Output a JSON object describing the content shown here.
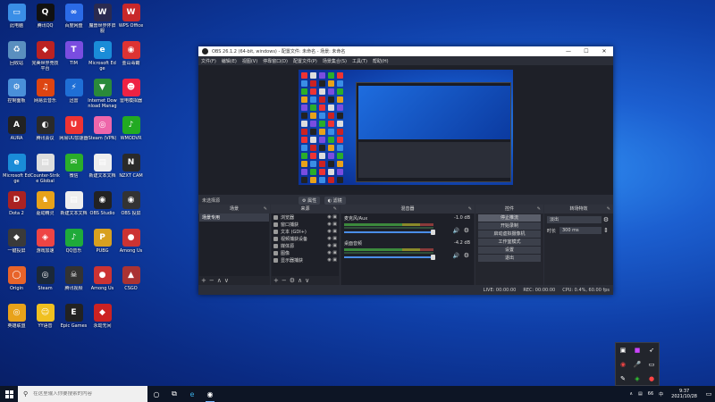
{
  "desktop": {
    "icons": [
      {
        "label": "此电脑",
        "glyph": "▭",
        "color": "#3a8ee6"
      },
      {
        "label": "腾讯QQ",
        "glyph": "Q",
        "color": "#111"
      },
      {
        "label": "百度网盘",
        "glyph": "∞",
        "color": "#2b6be6"
      },
      {
        "label": "魔兽世界怀旧服",
        "glyph": "W",
        "color": "#2a2a50"
      },
      {
        "label": "WPS Office",
        "glyph": "W",
        "color": "#c8282a"
      },
      {
        "label": "回收站",
        "glyph": "♻",
        "color": "#5a8fbf"
      },
      {
        "label": "完美世界竞技平台",
        "glyph": "◆",
        "color": "#b22"
      },
      {
        "label": "TIM",
        "glyph": "T",
        "color": "#7a4de0"
      },
      {
        "label": "Microsoft Edge",
        "glyph": "e",
        "color": "#1a8cd8"
      },
      {
        "label": "金山毒霸",
        "glyph": "◉",
        "color": "#d33"
      },
      {
        "label": "控制面板",
        "glyph": "⚙",
        "color": "#4a90d9"
      },
      {
        "label": "网易云音乐",
        "glyph": "♫",
        "color": "#d41"
      },
      {
        "label": "迅雷",
        "glyph": "⚡",
        "color": "#1f6fd6"
      },
      {
        "label": "Internet Download Manager",
        "glyph": "▼",
        "color": "#2a8a3a"
      },
      {
        "label": "雷电模拟器",
        "glyph": "☻",
        "color": "#e24"
      },
      {
        "label": "AURA",
        "glyph": "A",
        "color": "#222"
      },
      {
        "label": "腾讯会议",
        "glyph": "◐",
        "color": "#2a2a2a"
      },
      {
        "label": "网易UU加速器",
        "glyph": "U",
        "color": "#e33"
      },
      {
        "label": "Steam (VPN)",
        "glyph": "◎",
        "color": "#e6a"
      },
      {
        "label": "WMODVR",
        "glyph": "♪",
        "color": "#2a2"
      },
      {
        "label": "Microsoft Edge",
        "glyph": "e",
        "color": "#1a8cd8"
      },
      {
        "label": "Counter-Strike Global",
        "glyph": "▤",
        "color": "#ddd"
      },
      {
        "label": "微信",
        "glyph": "✉",
        "color": "#2aae2a"
      },
      {
        "label": "新建文本文档",
        "glyph": "▤",
        "color": "#eee"
      },
      {
        "label": "NZXT CAM",
        "glyph": "N",
        "color": "#2a2a2a"
      },
      {
        "label": "Dota 2",
        "glyph": "D",
        "color": "#a22"
      },
      {
        "label": "驱动精灵",
        "glyph": "♞",
        "color": "#e8a21a"
      },
      {
        "label": "新建文本文档",
        "glyph": "▤",
        "color": "#eee"
      },
      {
        "label": "OBS Studio",
        "glyph": "◉",
        "color": "#222"
      },
      {
        "label": "OBS 投屏",
        "glyph": "◉",
        "color": "#333"
      },
      {
        "label": "一键投屏",
        "glyph": "◆",
        "color": "#3a3a3a"
      },
      {
        "label": "游戏加速",
        "glyph": "◈",
        "color": "#e44"
      },
      {
        "label": "QQ音乐",
        "glyph": "♪",
        "color": "#1faa3a"
      },
      {
        "label": "PUBG",
        "glyph": "P",
        "color": "#d8a020"
      },
      {
        "label": "Among Us",
        "glyph": "●",
        "color": "#c33"
      },
      {
        "label": "Origin",
        "glyph": "◯",
        "color": "#e8642a"
      },
      {
        "label": "Steam",
        "glyph": "◎",
        "color": "#1b2838"
      },
      {
        "label": "腾讯视频",
        "glyph": "☠",
        "color": "#333"
      },
      {
        "label": "Among Us",
        "glyph": "●",
        "color": "#c33"
      },
      {
        "label": "CSGO",
        "glyph": "▲",
        "color": "#a33"
      },
      {
        "label": "英雄联盟",
        "glyph": "◎",
        "color": "#e8a21a"
      },
      {
        "label": "YY语音",
        "glyph": "☺",
        "color": "#f0c020"
      },
      {
        "label": "Epic Games",
        "glyph": "E",
        "color": "#222"
      },
      {
        "label": "永劫无间",
        "glyph": "◆",
        "color": "#c22"
      }
    ]
  },
  "obs": {
    "title": "OBS 26.1.2 (64-bit, windows) - 配置文件: 未命名 - 场景: 未命名",
    "menu": [
      "文件(F)",
      "编辑(E)",
      "视图(V)",
      "停靠窗口(D)",
      "配置文件(P)",
      "场景集合(S)",
      "工具(T)",
      "帮助(H)"
    ],
    "scene_header": "未选择源",
    "scene_buttons": [
      "属性",
      "滤镜"
    ],
    "docks": {
      "scenes": {
        "title": "场景",
        "items": [
          "场景专用"
        ]
      },
      "sources": {
        "title": "来源",
        "items": [
          "浏览器",
          "窗口捕获",
          "文本 (GDI+)",
          "视频捕获设备",
          "媒体源",
          "图像",
          "显示器捕获"
        ]
      },
      "mixer": {
        "title": "混音器",
        "channels": [
          {
            "name": "麦克风/Aux",
            "db": "-1.0 dB"
          },
          {
            "name": "桌面音频",
            "db": "-4.2 dB"
          }
        ]
      },
      "controls": {
        "title": "控件",
        "buttons": [
          "停止推流",
          "开始录制",
          "启动虚拟摄像机",
          "工作室模式",
          "设置",
          "退出"
        ]
      },
      "transitions": {
        "title": "转场特效",
        "select": "淡出",
        "duration_label": "时长",
        "duration": "300 ms"
      }
    },
    "status": {
      "live": "LIVE: 00:00:00",
      "rec": "REC: 00:00:00",
      "cpu": "CPU: 0.4%, 60.00 fps"
    }
  },
  "taskbar": {
    "search_placeholder": "在这里输入你要搜索的内容",
    "time": "9:37",
    "date": "2021/10/28",
    "lang": "中",
    "tray_count": "66"
  }
}
